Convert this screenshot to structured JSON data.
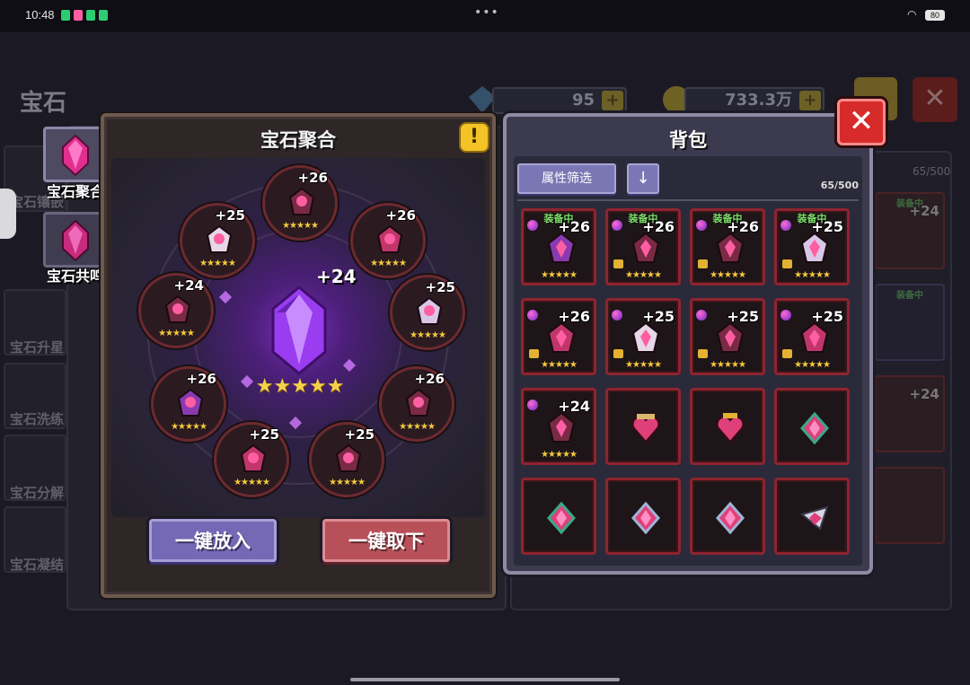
{
  "status": {
    "time": "10:48",
    "battery": "80",
    "dots": "•••"
  },
  "background": {
    "title": "宝石",
    "gem_count": "95",
    "gold_count": "733.3万",
    "close": "✕",
    "side_labels": [
      "宝石镶嵌",
      "宝石升星",
      "宝石洗练",
      "宝石分解",
      "宝石凝结"
    ],
    "right_count": "65/500",
    "right_tags": [
      "装备中",
      "装备中"
    ],
    "right_levels": [
      "+24",
      "+24"
    ]
  },
  "side_tabs": [
    {
      "label": "宝石聚合"
    },
    {
      "label": "宝石共鸣"
    }
  ],
  "fusion": {
    "title": "宝石聚合",
    "warn": "!",
    "center_level": "+24",
    "center_stars": "★★★★★",
    "slots": [
      {
        "level": "+26",
        "stars": "★★★★★",
        "color": "#7a2a44"
      },
      {
        "level": "+26",
        "stars": "★★★★★",
        "color": "#c0366b"
      },
      {
        "level": "+25",
        "stars": "★★★★★",
        "color": "#e6d8e8"
      },
      {
        "level": "+25",
        "stars": "★★★★★",
        "color": "#d8c7e6"
      },
      {
        "level": "+24",
        "stars": "★★★★★",
        "color": "#7a2a44"
      },
      {
        "level": "+26",
        "stars": "★★★★★",
        "color": "#7a2a44"
      },
      {
        "level": "+26",
        "stars": "★★★★★",
        "color": "#8a3ab0"
      },
      {
        "level": "+25",
        "stars": "★★★★★",
        "color": "#c0366b"
      },
      {
        "level": "+25",
        "stars": "★★★★★",
        "color": "#7a2a44"
      }
    ],
    "put_all": "一键放入",
    "take_all": "一键取下"
  },
  "bag": {
    "title": "背包",
    "close": "✕",
    "filter": "属性筛选",
    "sort_icon": "↓",
    "count": "65/500",
    "cells": [
      {
        "tag": "装备中",
        "level": "+26",
        "stars": "★★★★★",
        "color": "#8a3ab0"
      },
      {
        "tag": "装备中",
        "level": "+26",
        "stars": "★★★★★",
        "color": "#7a2a44"
      },
      {
        "tag": "装备中",
        "level": "+26",
        "stars": "★★★★★",
        "color": "#7a2a44"
      },
      {
        "tag": "装备中",
        "level": "+25",
        "stars": "★★★★★",
        "color": "#d8c7e6"
      },
      {
        "tag": "",
        "level": "+26",
        "stars": "★★★★★",
        "color": "#c0366b"
      },
      {
        "tag": "",
        "level": "+25",
        "stars": "★★★★★",
        "color": "#e6d8e8"
      },
      {
        "tag": "",
        "level": "+25",
        "stars": "★★★★★",
        "color": "#7a2a44"
      },
      {
        "tag": "",
        "level": "+25",
        "stars": "★★★★★",
        "color": "#c0366b"
      },
      {
        "tag": "",
        "level": "+24",
        "stars": "★★★★★",
        "color": "#7a2a44"
      },
      {
        "tag": "",
        "level": "",
        "stars": "",
        "color": "#e0407a"
      },
      {
        "tag": "",
        "level": "",
        "stars": "",
        "color": "#e0407a"
      },
      {
        "tag": "",
        "level": "",
        "stars": "",
        "color": "#e0407a"
      },
      {
        "tag": "",
        "level": "",
        "stars": "",
        "color": "#e0407a"
      },
      {
        "tag": "",
        "level": "",
        "stars": "",
        "color": "#e0407a"
      },
      {
        "tag": "",
        "level": "",
        "stars": "",
        "color": "#e0407a"
      },
      {
        "tag": "",
        "level": "",
        "stars": "",
        "color": "#e0407a"
      }
    ]
  }
}
